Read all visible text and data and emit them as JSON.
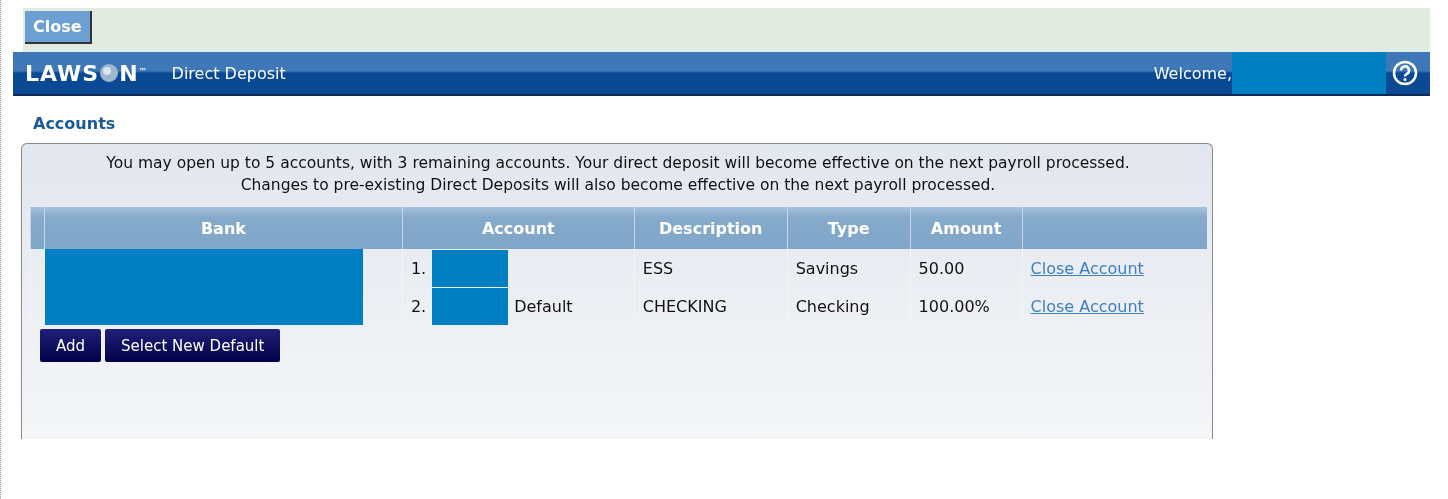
{
  "top_bar": {
    "close_button": "Close"
  },
  "header": {
    "logo": {
      "before": "LAWS",
      "after": "N",
      "mark": "™"
    },
    "title": "Direct Deposit",
    "welcome": "Welcome,"
  },
  "section_title": "Accounts",
  "notice": [
    "You may open up to 5 accounts, with 3 remaining accounts.  Your direct deposit will become effective on the next payroll processed.",
    "Changes to pre-existing Direct Deposits will also become effective on the next payroll processed."
  ],
  "table": {
    "columns": [
      "Bank",
      "Account",
      "Description",
      "Type",
      "Amount"
    ],
    "rows": [
      {
        "number": "1.",
        "account_suffix": "",
        "description": "ESS",
        "type": "Savings",
        "amount": "50.00",
        "action": "Close Account"
      },
      {
        "number": "2.",
        "account_suffix": "Default",
        "description": "CHECKING",
        "type": "Checking",
        "amount": "100.00%",
        "action": "Close Account"
      }
    ]
  },
  "buttons": [
    "Add",
    "Select New Default"
  ]
}
